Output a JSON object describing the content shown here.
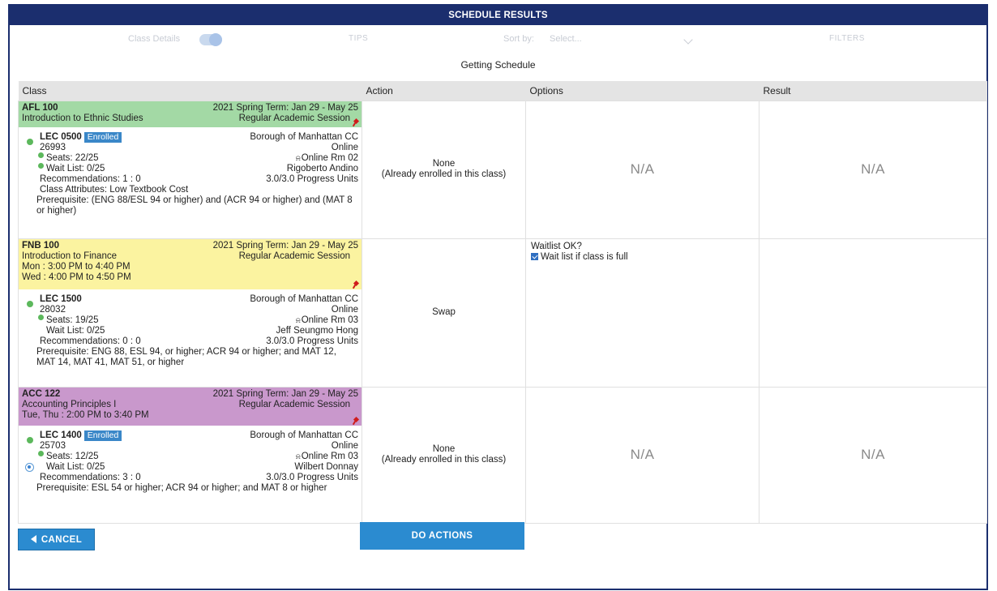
{
  "dialog": {
    "title": "SCHEDULE RESULTS"
  },
  "toolbar": {
    "class_details_label": "Class Details",
    "tips_label": "TIPS",
    "sort_by_label": "Sort by:",
    "sort_select_placeholder": "Select...",
    "filters_label": "FILTERS"
  },
  "status_text": "Getting Schedule",
  "table": {
    "headers": [
      "Class",
      "Action",
      "Options",
      "Result"
    ],
    "rows": [
      {
        "header_color": "#a3d9a5",
        "course_code": "AFL 100",
        "term": "2021 Spring Term: Jan 29 - May 25",
        "course_title": "Introduction to Ethnic Studies",
        "session": "Regular Academic Session",
        "meeting_times": [],
        "section": "LEC 0500",
        "badge": "Enrolled",
        "class_number": "26993",
        "seats": "Seats: 22/25",
        "waitlist": "Wait List: 0/25",
        "recommendations": "Recommendations: 1 : 0",
        "campus": "Borough of Manhattan CC",
        "location": "Online",
        "room": "Online Rm 02",
        "instructor": "Rigoberto Andino",
        "units": "3.0/3.0 Progress Units",
        "attributes": "Class Attributes: Low Textbook Cost",
        "prerequisite": "Prerequisite: (ENG 88/ESL 94 or higher) and (ACR 94 or higher) and (MAT 8 or higher)",
        "action_line1": "None",
        "action_line2": "(Already enrolled in this class)",
        "options": "N/A",
        "result": "N/A"
      },
      {
        "header_color": "#fbf3a0",
        "course_code": "FNB 100",
        "term": "2021 Spring Term: Jan 29 - May 25",
        "course_title": "Introduction to Finance",
        "session": "Regular Academic Session",
        "meeting_times": [
          "Mon : 3:00 PM to 4:40 PM",
          "Wed : 4:00 PM to 4:50 PM"
        ],
        "section": "LEC 1500",
        "class_number": "28032",
        "seats": "Seats: 19/25",
        "waitlist": "Wait List: 0/25",
        "recommendations": "Recommendations: 0 : 0",
        "campus": "Borough of Manhattan CC",
        "location": "Online",
        "room": "Online Rm 03",
        "instructor": "Jeff Seungmo Hong",
        "units": "3.0/3.0 Progress Units",
        "prerequisite": "Prerequisite: ENG 88, ESL 94, or higher; ACR 94 or higher; and MAT 12, MAT 14, MAT 41, MAT 51, or higher",
        "action_line1": "Swap",
        "options_title": "Waitlist OK?",
        "options_checkbox_label": "Wait list if class is full",
        "options_checked": true,
        "result": ""
      },
      {
        "header_color": "#c998cc",
        "course_code": "ACC 122",
        "term": "2021 Spring Term: Jan 29 - May 25",
        "course_title": "Accounting Principles I",
        "session": "Regular Academic Session",
        "meeting_times": [
          "Tue, Thu : 2:00 PM to 3:40 PM"
        ],
        "section": "LEC 1400",
        "badge": "Enrolled",
        "class_number": "25703",
        "seats": "Seats: 12/25",
        "waitlist": "Wait List: 0/25",
        "recommendations": "Recommendations: 3 : 0",
        "campus": "Borough of Manhattan CC",
        "location": "Online",
        "room": "Online Rm 03",
        "instructor": "Wilbert Donnay",
        "units": "3.0/3.0 Progress Units",
        "prerequisite": "Prerequisite: ESL 54 or higher; ACR 94 or higher; and MAT 8 or higher",
        "action_line1": "None",
        "action_line2": "(Already enrolled in this class)",
        "options": "N/A",
        "result": "N/A"
      }
    ]
  },
  "buttons": {
    "cancel": "CANCEL",
    "do_actions": "DO ACTIONS"
  },
  "colors": {
    "header_bar": "#1b2e6e",
    "button": "#2b8bd0",
    "badge": "#3a87c8",
    "status_dot": "#5cb85c"
  },
  "icons": [
    "toggle-switch",
    "chevron-down-icon",
    "pin-icon",
    "status-dot-icon",
    "room-icon",
    "radio-icon",
    "checkbox-icon",
    "back-triangle-icon"
  ]
}
